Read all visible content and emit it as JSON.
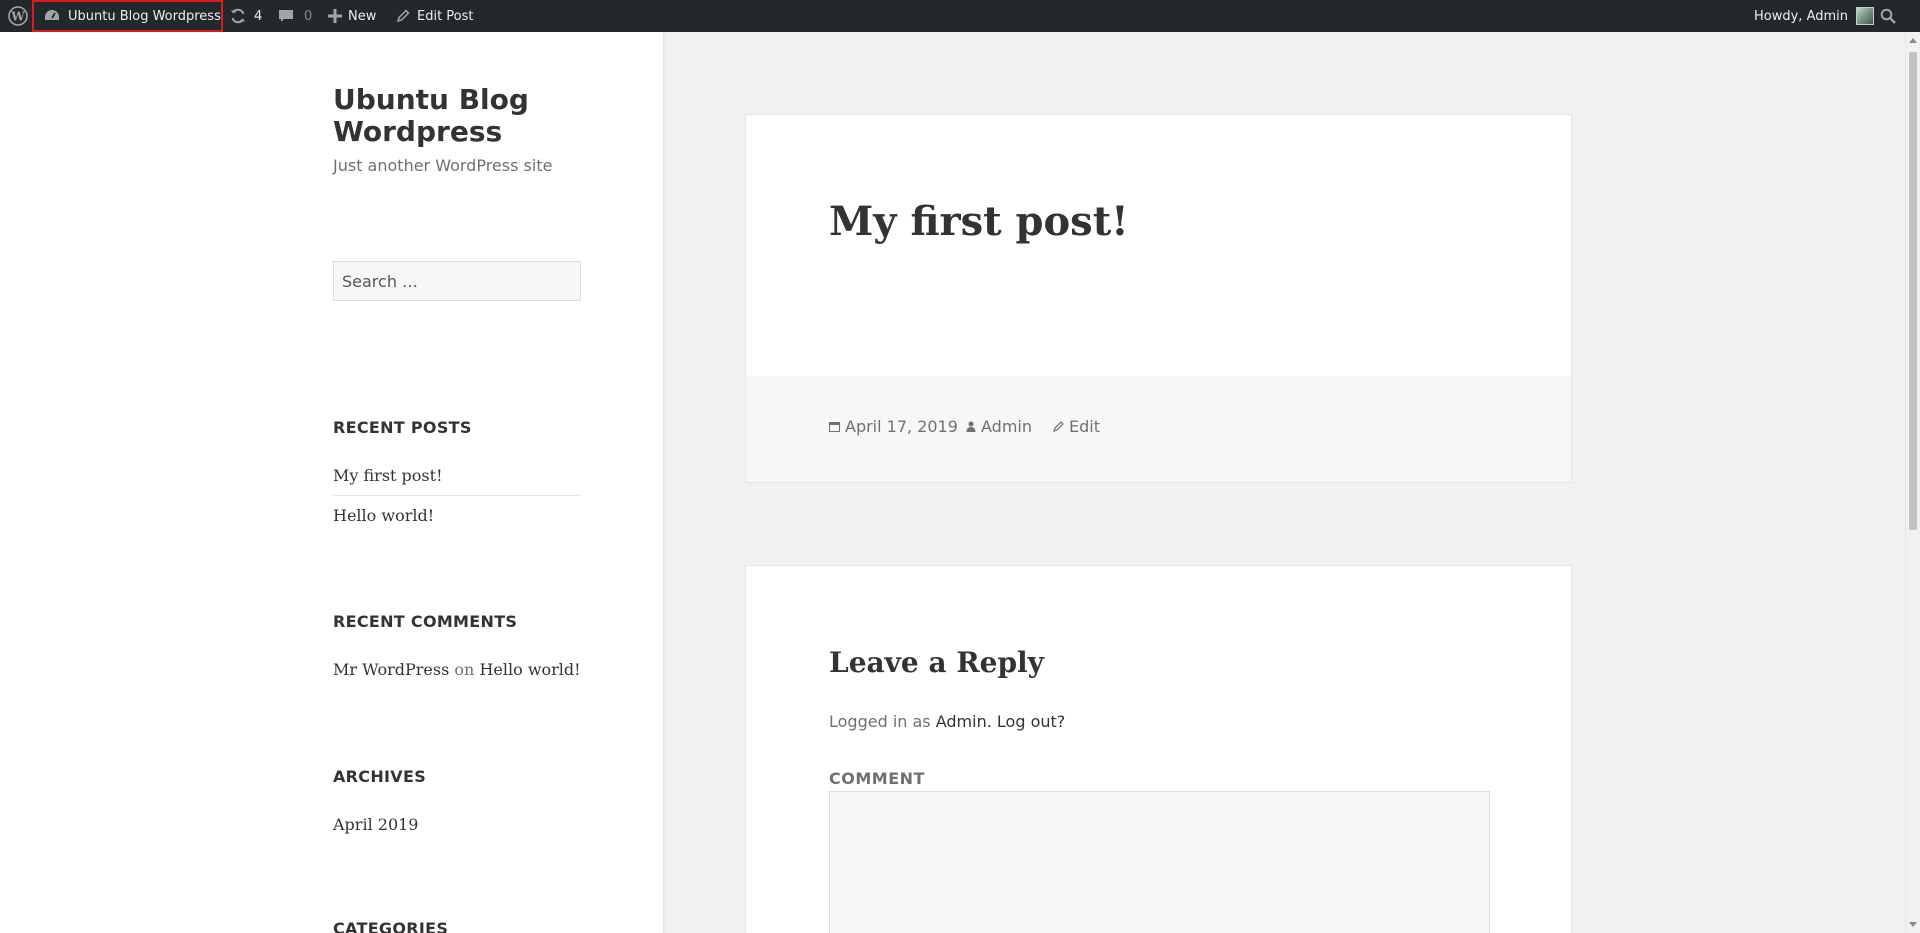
{
  "admin_bar": {
    "site_name": "Ubuntu Blog Wordpress",
    "updates_count": "4",
    "comments_count": "0",
    "new_label": "New",
    "edit_label": "Edit Post",
    "greeting": "Howdy, Admin"
  },
  "sidebar": {
    "site_title": "Ubuntu Blog Wordpress",
    "tagline": "Just another WordPress site",
    "search_placeholder": "Search …",
    "recent_posts_title": "RECENT POSTS",
    "recent_posts": [
      "My first post!",
      "Hello world!"
    ],
    "recent_comments_title": "RECENT COMMENTS",
    "recent_comment": {
      "author": "Mr WordPress",
      "on": "on",
      "post": "Hello world!"
    },
    "archives_title": "ARCHIVES",
    "archives": [
      "April 2019"
    ],
    "categories_title": "CATEGORIES"
  },
  "post": {
    "title": "My first post!",
    "date": "April 17, 2019",
    "author": "Admin",
    "edit": "Edit"
  },
  "reply": {
    "title": "Leave a Reply",
    "logged_in_prefix": "Logged in as",
    "logged_in_user": "Admin.",
    "logout": "Log out?",
    "comment_label": "COMMENT"
  },
  "colors": {
    "admin_bar_bg": "#23282d",
    "highlight_border": "#e0191b",
    "page_bg": "#f1f1f1",
    "card_bg": "#ffffff"
  }
}
